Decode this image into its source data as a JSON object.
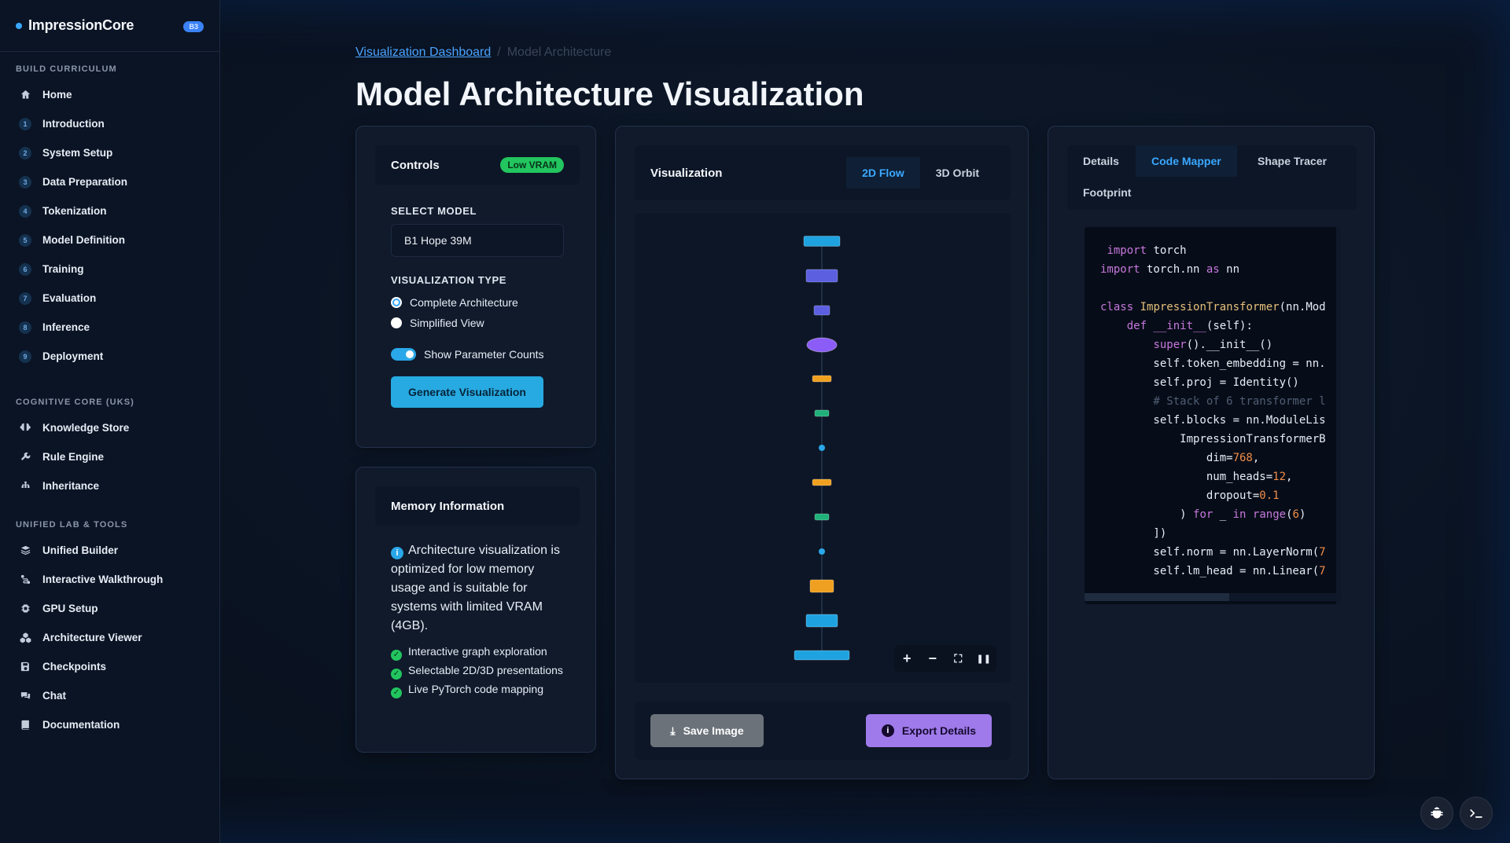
{
  "brand": {
    "name": "ImpressionCore",
    "badge": "B3"
  },
  "sidebar": {
    "sections": [
      {
        "title": "BUILD CURRICULUM",
        "items": [
          {
            "label": "Home",
            "icon": "home-icon"
          },
          {
            "label": "Introduction",
            "num": "1"
          },
          {
            "label": "System Setup",
            "num": "2"
          },
          {
            "label": "Data Preparation",
            "num": "3"
          },
          {
            "label": "Tokenization",
            "num": "4"
          },
          {
            "label": "Model Definition",
            "num": "5"
          },
          {
            "label": "Training",
            "num": "6"
          },
          {
            "label": "Evaluation",
            "num": "7"
          },
          {
            "label": "Inference",
            "num": "8"
          },
          {
            "label": "Deployment",
            "num": "9"
          }
        ]
      },
      {
        "title": "COGNITIVE CORE (UKS)",
        "items": [
          {
            "label": "Knowledge Store",
            "icon": "brain-icon"
          },
          {
            "label": "Rule Engine",
            "icon": "wrench-icon"
          },
          {
            "label": "Inheritance",
            "icon": "hierarchy-icon"
          }
        ]
      },
      {
        "title": "UNIFIED LAB & TOOLS",
        "items": [
          {
            "label": "Unified Builder",
            "icon": "layers-icon"
          },
          {
            "label": "Interactive Walkthrough",
            "icon": "route-icon"
          },
          {
            "label": "GPU Setup",
            "icon": "chip-icon"
          },
          {
            "label": "Architecture Viewer",
            "icon": "cubes-icon"
          },
          {
            "label": "Checkpoints",
            "icon": "save-icon"
          },
          {
            "label": "Chat",
            "icon": "chat-icon"
          },
          {
            "label": "Documentation",
            "icon": "book-icon"
          }
        ]
      }
    ]
  },
  "breadcrumb": {
    "parent": "Visualization Dashboard",
    "separator": "/",
    "current": "Model Architecture"
  },
  "page": {
    "title": "Model Architecture Visualization"
  },
  "controls": {
    "title": "Controls",
    "badge": "Low VRAM",
    "select_label": "SELECT MODEL",
    "select_value": "B1 Hope 39M",
    "viz_type_label": "VISUALIZATION TYPE",
    "options": [
      "Complete Architecture",
      "Simplified View"
    ],
    "selected_option": "Complete Architecture",
    "toggle_label": "Show Parameter Counts",
    "toggle_on": true,
    "generate_label": "Generate Visualization"
  },
  "memory": {
    "title": "Memory Information",
    "text": "Architecture visualization is optimized for low memory usage and is suitable for systems with limited VRAM (4GB).",
    "features": [
      "Interactive graph exploration",
      "Selectable 2D/3D presentations",
      "Live PyTorch code mapping"
    ]
  },
  "visualization": {
    "title": "Visualization",
    "tabs": [
      "2D Flow",
      "3D Orbit"
    ],
    "active_tab": "2D Flow",
    "zoom_controls": [
      "+",
      "−",
      "⛶",
      "❚❚"
    ],
    "save_label": "Save Image",
    "export_label": "Export Details",
    "node_colors": {
      "embed": "#1fa3e0",
      "attn": "#5b5fe0",
      "norm": "#8b5cf6",
      "ff": "#f0a020",
      "res": "#20b07a",
      "node": "#2aa7e8"
    }
  },
  "code_panel": {
    "tabs": [
      "Details",
      "Code Mapper",
      "Shape Tracer",
      "Footprint"
    ],
    "active_tab": "Code Mapper"
  },
  "colors": {
    "accent": "#3aa8ff",
    "success": "#22c55e",
    "purple": "#9f7aea"
  }
}
